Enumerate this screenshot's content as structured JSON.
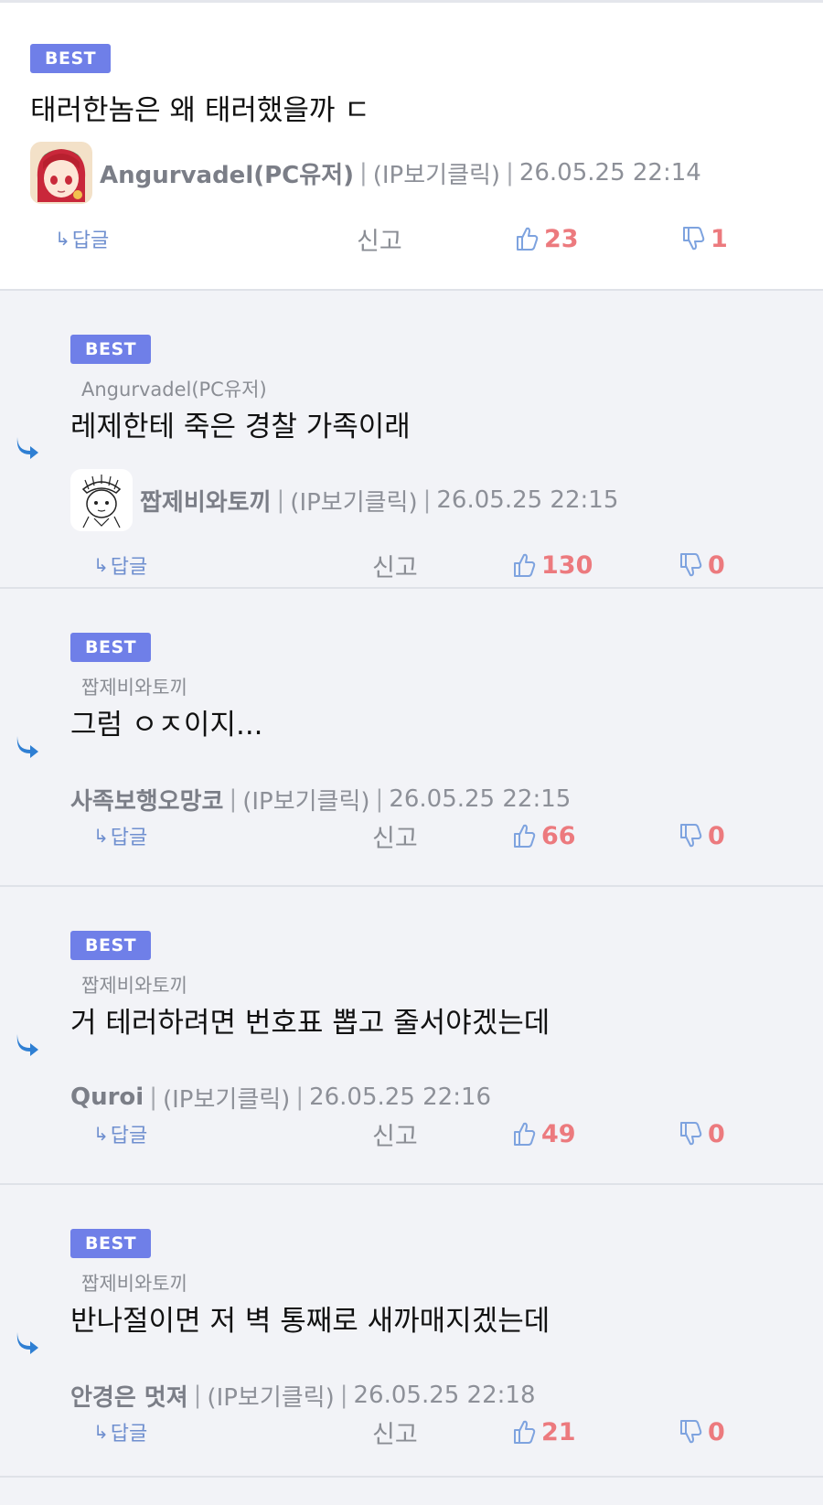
{
  "comments": [
    {
      "best_label": "BEST",
      "text": "태러한놈은 왜 태러했을까 ㄷ",
      "author": "Angurvadel(PC유저)",
      "separator": "|",
      "ip": "(IP보기클릭)",
      "date": "26.05.25 22:14",
      "reply_label": "답글",
      "report_label": "신고",
      "likes": "23",
      "dislikes": "1"
    },
    {
      "best_label": "BEST",
      "reply_to": "Angurvadel(PC유저)",
      "text": "레제한테 죽은 경찰 가족이래",
      "author": "짭제비와토끼",
      "separator": "|",
      "ip": "(IP보기클릭)",
      "date": "26.05.25 22:15",
      "reply_label": "답글",
      "report_label": "신고",
      "likes": "130",
      "dislikes": "0"
    },
    {
      "best_label": "BEST",
      "reply_to": "짭제비와토끼",
      "text": "그럼 ㅇㅈ이지...",
      "author": "사족보행오망코",
      "separator": "|",
      "ip": "(IP보기클릭)",
      "date": "26.05.25 22:15",
      "reply_label": "답글",
      "report_label": "신고",
      "likes": "66",
      "dislikes": "0"
    },
    {
      "best_label": "BEST",
      "reply_to": "짭제비와토끼",
      "text": "거 테러하려면 번호표 뽑고 줄서야겠는데",
      "author": "Quroi",
      "separator": "|",
      "ip": "(IP보기클릭)",
      "date": "26.05.25 22:16",
      "reply_label": "답글",
      "report_label": "신고",
      "likes": "49",
      "dislikes": "0"
    },
    {
      "best_label": "BEST",
      "reply_to": "짭제비와토끼",
      "text": "반나절이면 저 벽 통째로 새까매지겠는데",
      "author": "안경은 멋져",
      "separator": "|",
      "ip": "(IP보기클릭)",
      "date": "26.05.25 22:18",
      "reply_label": "답글",
      "report_label": "신고",
      "likes": "21",
      "dislikes": "0"
    }
  ],
  "icons": {
    "reply_marker": "reply-arrow-icon",
    "like": "thumbs-up-icon",
    "dislike": "thumbs-down-icon",
    "reply_small": "reply-small-arrow-icon"
  },
  "colors": {
    "best_badge": "#6f7fe8",
    "count": "#ec7a7e",
    "reply_link": "#6f8fcf",
    "reply_marker": "#2f7fd3"
  }
}
